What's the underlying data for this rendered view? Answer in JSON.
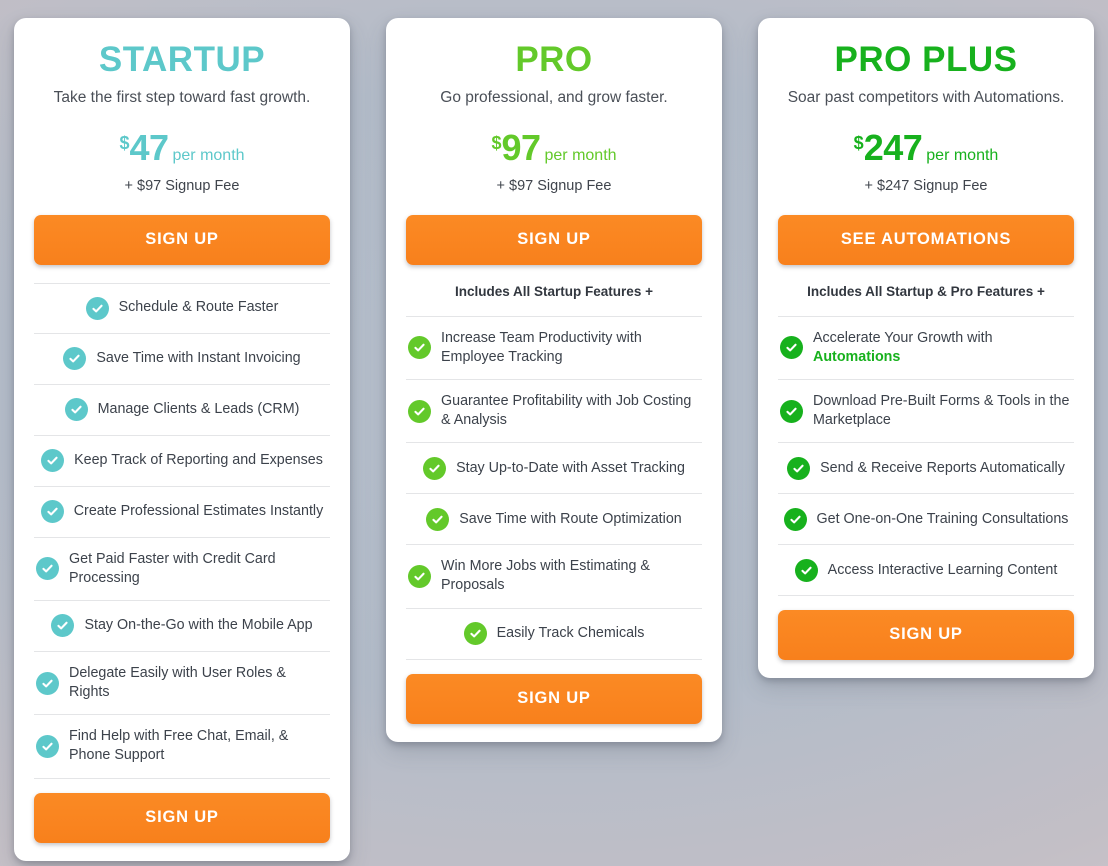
{
  "colors": {
    "teal": "#5dc8ca",
    "green": "#63c92a",
    "green_dark": "#17b11d",
    "orange": "#f8801c",
    "text": "#3c424b"
  },
  "plans": [
    {
      "id": "startup",
      "title": "STARTUP",
      "tagline": "Take the first step toward fast growth.",
      "currency": "$",
      "amount": "47",
      "period": "per month",
      "signup_fee": "+ $97 Signup Fee",
      "cta_top": "SIGN UP",
      "cta_bottom": "SIGN UP",
      "includes_line": "",
      "features": [
        "Schedule & Route Faster",
        "Save Time with Instant Invoicing",
        "Manage Clients & Leads (CRM)",
        "Keep Track of Reporting and Expenses",
        "Create Professional Estimates Instantly",
        "Get Paid Faster with Credit Card Processing",
        "Stay On-the-Go with the Mobile App",
        "Delegate Easily with User Roles & Rights",
        "Find Help with Free Chat, Email, & Phone Support"
      ]
    },
    {
      "id": "pro",
      "title": "PRO",
      "tagline": "Go professional, and grow faster.",
      "currency": "$",
      "amount": "97",
      "period": "per month",
      "signup_fee": "+ $97 Signup Fee",
      "cta_top": "SIGN UP",
      "cta_bottom": "SIGN UP",
      "includes_line": "Includes All Startup Features +",
      "features": [
        "Increase Team Productivity with Employee Tracking",
        "Guarantee Profitability with Job Costing & Analysis",
        "Stay Up-to-Date with Asset Tracking",
        "Save Time with Route Optimization",
        "Win More Jobs with Estimating & Proposals",
        "Easily Track Chemicals"
      ]
    },
    {
      "id": "proplus",
      "title": "PRO PLUS",
      "tagline": "Soar past competitors with Automations.",
      "currency": "$",
      "amount": "247",
      "period": "per month",
      "signup_fee": "+ $247 Signup Fee",
      "cta_top": "SEE AUTOMATIONS",
      "cta_bottom": "SIGN UP",
      "includes_line": "Includes All Startup & Pro Features +",
      "features": [
        "Accelerate Your Growth with Automations",
        "Download Pre-Built Forms & Tools in the Marketplace",
        "Send & Receive Reports Automatically",
        "Get One-on-One Training Consultations",
        "Access Interactive Learning Content"
      ],
      "feature_highlights": {
        "0": "Automations"
      }
    }
  ],
  "icons": {
    "check": "check-circle-icon"
  }
}
